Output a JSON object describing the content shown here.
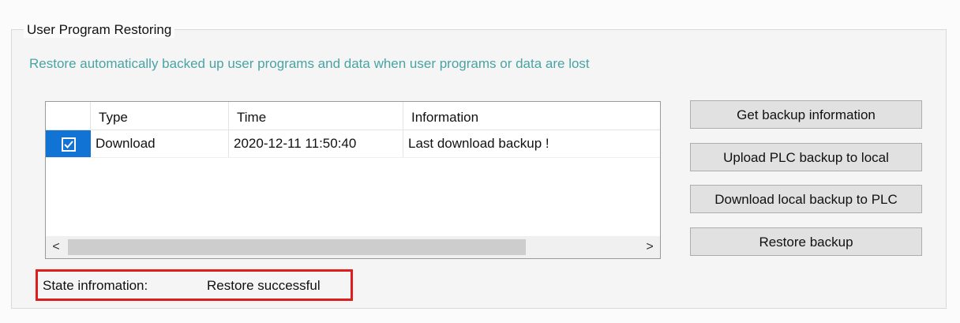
{
  "group": {
    "title": "User Program Restoring",
    "subtitle": "Restore automatically backed up user programs and data when user programs or data are lost"
  },
  "table": {
    "columns": [
      "",
      "Type",
      "Time",
      "Information"
    ],
    "rows": [
      {
        "checked": true,
        "type": "Download",
        "time": "2020-12-11 11:50:40",
        "information": "Last download backup !"
      }
    ]
  },
  "scrollbar": {
    "left_arrow": "<",
    "right_arrow": ">"
  },
  "buttons": {
    "get_backup_info": "Get backup information",
    "upload_plc_backup": "Upload PLC backup to local",
    "download_local_backup": "Download local backup to PLC",
    "restore_backup": "Restore backup"
  },
  "state": {
    "label": "State infromation:",
    "value": "Restore successful",
    "highlight_color": "#e01d1d"
  },
  "colors": {
    "subtitle": "#4aa3a3",
    "selection": "#1173d4"
  }
}
